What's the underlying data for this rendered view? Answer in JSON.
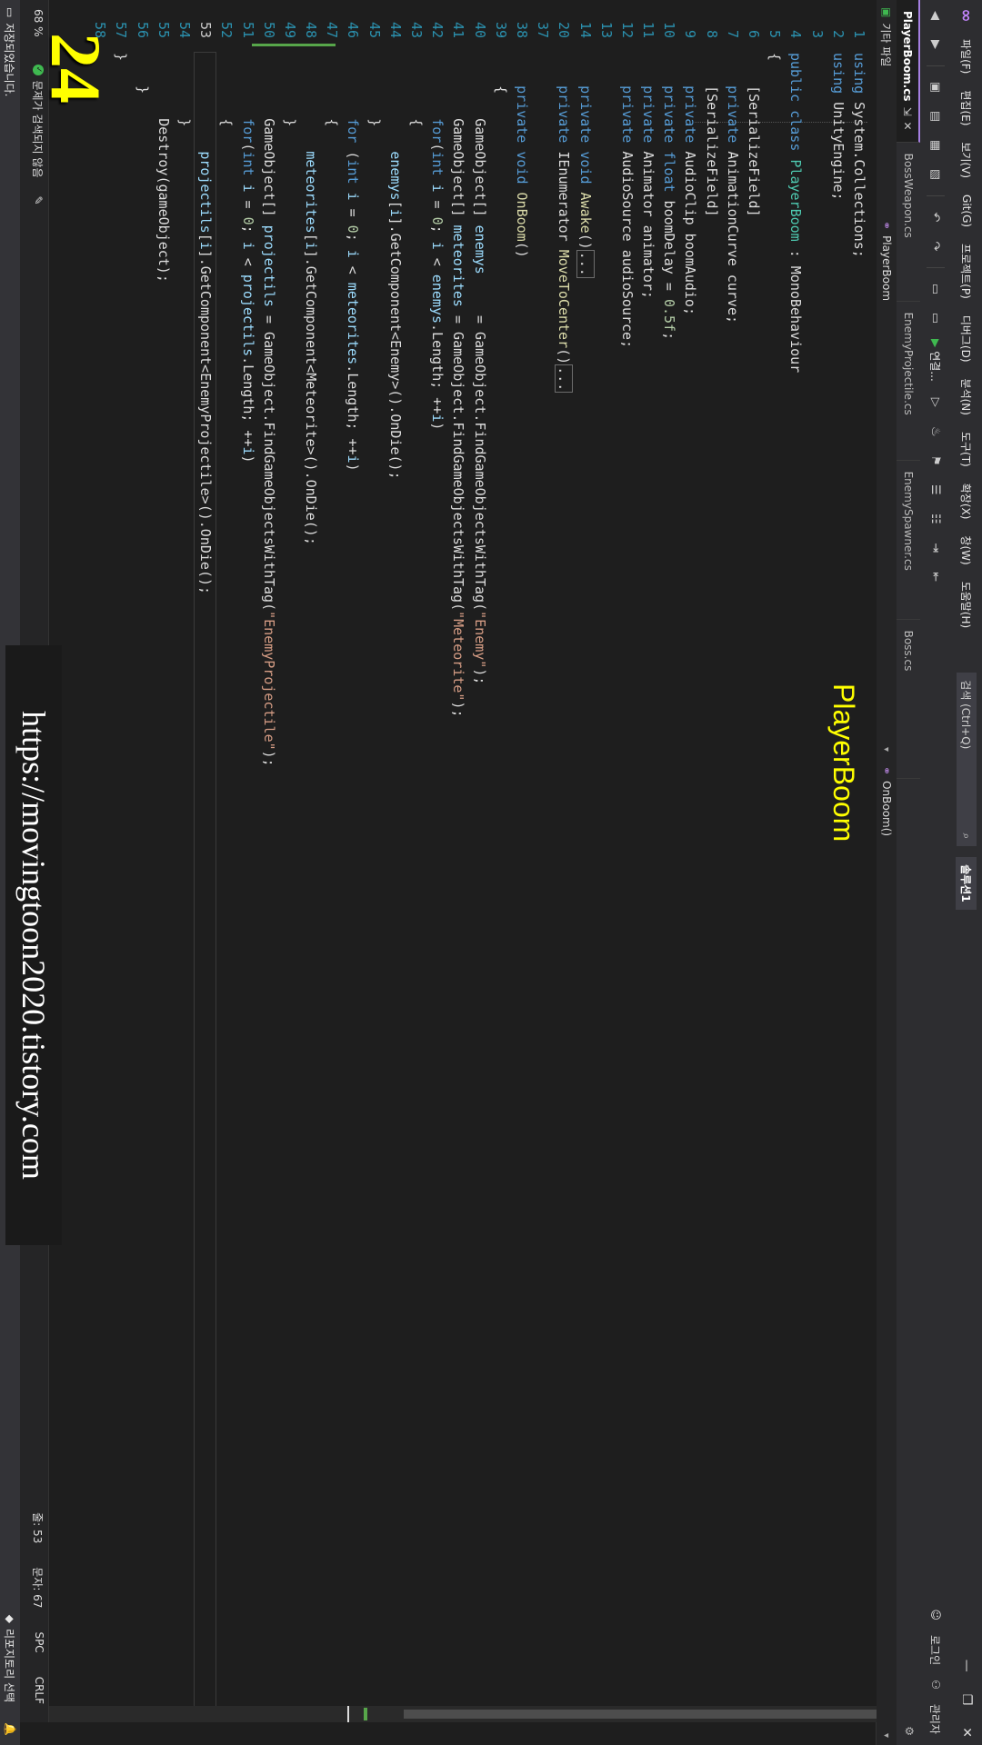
{
  "menubar": {
    "items": [
      "파일(F)",
      "편집(E)",
      "보기(V)",
      "Git(G)",
      "프로젝트(P)",
      "디버그(D)",
      "분석(N)",
      "도구(T)",
      "확장(X)",
      "창(W)",
      "도움말(H)"
    ],
    "search_label": "검색 (Ctrl+Q)",
    "solution": "솔루션1",
    "window_controls": [
      "—",
      "❐",
      "✕"
    ]
  },
  "toolbar": {
    "run_label": "연결...",
    "live_share": "관리자",
    "feedback": "로그인"
  },
  "tabs": [
    {
      "label": "PlayerBoom.cs",
      "active": true
    },
    {
      "label": "BossWeapon.cs",
      "active": false
    },
    {
      "label": "EnemyProjectile.cs",
      "active": false
    },
    {
      "label": "EnemySpawner.cs",
      "active": false
    },
    {
      "label": "Boss.cs",
      "active": false
    }
  ],
  "tabs_icon": "gear-icon",
  "navbar": {
    "project": "기타 파일",
    "class": "PlayerBoom",
    "member": "OnBoom()"
  },
  "editor": {
    "line_numbers": [
      "1",
      "2",
      "3",
      "4",
      "5",
      "6",
      "7",
      "8",
      "9",
      "10",
      "11",
      "12",
      "13",
      "14",
      "20",
      "37",
      "38",
      "39",
      "40",
      "41",
      "42",
      "43",
      "44",
      "45",
      "46",
      "47",
      "48",
      "49",
      "50",
      "51",
      "52",
      "53",
      "54",
      "55",
      "56",
      "57",
      "58"
    ],
    "current_line_index": 31
  },
  "infobar": {
    "zoom": "68 %",
    "issues": "문제가 검색되지 않음",
    "line": "줄: 53",
    "col": "문자: 67",
    "spacing": "SPC",
    "eol": "CRLF"
  },
  "statusbar": {
    "message": "저장되었습니다.",
    "repo": "리포지토리 선택"
  },
  "overlay": {
    "episode_number": "24",
    "title": "PlayerBoom",
    "watermark": "https://movingtoon2020.tistory.com"
  },
  "colors": {
    "keyword": "#569cd6",
    "type": "#4ec9b0",
    "string": "#d69d85",
    "number": "#b5cea8",
    "overlay_text": "#ffff00",
    "accent": "#a57fe0"
  }
}
